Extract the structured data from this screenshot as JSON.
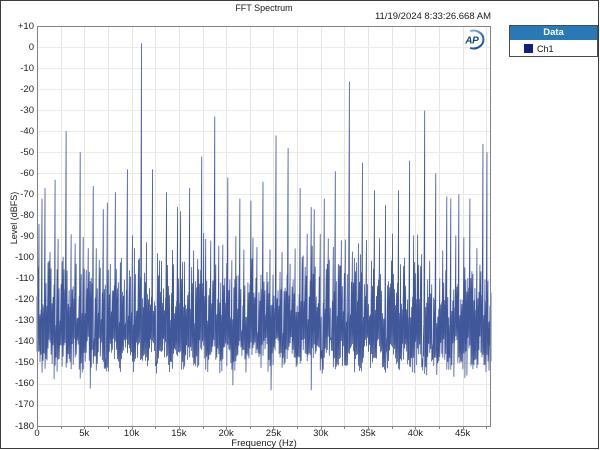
{
  "window": {
    "border_color": "#3c3c3c",
    "background": "#ffffff"
  },
  "header": {
    "title": "FFT Spectrum",
    "timestamp": "11/19/2024 8:33:26.668 AM"
  },
  "logo": {
    "text": "AP",
    "text_color": "#15457f",
    "arc_color": "#2b6cad"
  },
  "legend": {
    "header": "Data",
    "header_bg": "#2879b5",
    "header_text_color": "#ffffff",
    "items": [
      {
        "label": "Ch1",
        "swatch_color": "#141f7b"
      }
    ]
  },
  "chart_data": {
    "type": "line",
    "title": "FFT Spectrum",
    "xlabel": "Frequency (Hz)",
    "ylabel": "Level (dBFS)",
    "xlim": [
      0,
      48000
    ],
    "ylim": [
      -180,
      10
    ],
    "grid": true,
    "x_grid_step_hz": 2500,
    "y_grid_step_db": 10,
    "x_ticks": [
      {
        "value": 0,
        "label": "0"
      },
      {
        "value": 5000,
        "label": "5k"
      },
      {
        "value": 10000,
        "label": "10k"
      },
      {
        "value": 15000,
        "label": "15k"
      },
      {
        "value": 20000,
        "label": "20k"
      },
      {
        "value": 25000,
        "label": "25k"
      },
      {
        "value": 30000,
        "label": "30k"
      },
      {
        "value": 35000,
        "label": "35k"
      },
      {
        "value": 40000,
        "label": "40k"
      },
      {
        "value": 45000,
        "label": "45k"
      }
    ],
    "y_ticks": [
      {
        "value": 10,
        "label": "+10"
      },
      {
        "value": 0,
        "label": "0"
      },
      {
        "value": -10,
        "label": "-10"
      },
      {
        "value": -20,
        "label": "-20"
      },
      {
        "value": -30,
        "label": "-30"
      },
      {
        "value": -40,
        "label": "-40"
      },
      {
        "value": -50,
        "label": "-50"
      },
      {
        "value": -60,
        "label": "-60"
      },
      {
        "value": -70,
        "label": "-70"
      },
      {
        "value": -80,
        "label": "-80"
      },
      {
        "value": -90,
        "label": "-90"
      },
      {
        "value": -100,
        "label": "-100"
      },
      {
        "value": -110,
        "label": "-110"
      },
      {
        "value": -120,
        "label": "-120"
      },
      {
        "value": -130,
        "label": "-130"
      },
      {
        "value": -140,
        "label": "-140"
      },
      {
        "value": -150,
        "label": "-150"
      },
      {
        "value": -160,
        "label": "-160"
      },
      {
        "value": -170,
        "label": "-170"
      },
      {
        "value": -180,
        "label": "-180"
      }
    ],
    "series": [
      {
        "name": "Ch1",
        "color": "#40579a"
      }
    ],
    "peaks": [
      {
        "f": 250,
        "db": -84
      },
      {
        "f": 550,
        "db": -72
      },
      {
        "f": 800,
        "db": -67
      },
      {
        "f": 1870,
        "db": -63
      },
      {
        "f": 3100,
        "db": -40
      },
      {
        "f": 4550,
        "db": -50
      },
      {
        "f": 5900,
        "db": -66
      },
      {
        "f": 7000,
        "db": -77
      },
      {
        "f": 7450,
        "db": -74
      },
      {
        "f": 8300,
        "db": -69
      },
      {
        "f": 9600,
        "db": -58
      },
      {
        "f": 11000,
        "db": 1.8
      },
      {
        "f": 12250,
        "db": -58
      },
      {
        "f": 13700,
        "db": -69
      },
      {
        "f": 14850,
        "db": -76
      },
      {
        "f": 15150,
        "db": -78
      },
      {
        "f": 16100,
        "db": -67
      },
      {
        "f": 17400,
        "db": -52
      },
      {
        "f": 18800,
        "db": -33
      },
      {
        "f": 20200,
        "db": -62
      },
      {
        "f": 21400,
        "db": -72
      },
      {
        "f": 22600,
        "db": -73
      },
      {
        "f": 23900,
        "db": -64
      },
      {
        "f": 25300,
        "db": -42
      },
      {
        "f": 26600,
        "db": -48
      },
      {
        "f": 27800,
        "db": -67
      },
      {
        "f": 29000,
        "db": -76
      },
      {
        "f": 29300,
        "db": -77
      },
      {
        "f": 30400,
        "db": -72
      },
      {
        "f": 31500,
        "db": -59
      },
      {
        "f": 33000,
        "db": -16.4
      },
      {
        "f": 34400,
        "db": -55
      },
      {
        "f": 35700,
        "db": -68
      },
      {
        "f": 36900,
        "db": -75
      },
      {
        "f": 38200,
        "db": -68
      },
      {
        "f": 39400,
        "db": -54
      },
      {
        "f": 41000,
        "db": -30.2
      },
      {
        "f": 42200,
        "db": -60
      },
      {
        "f": 43300,
        "db": -71
      },
      {
        "f": 43700,
        "db": -72
      },
      {
        "f": 44600,
        "db": -70
      },
      {
        "f": 45800,
        "db": -72
      },
      {
        "f": 47200,
        "db": -46
      },
      {
        "f": 47550,
        "db": -50
      }
    ],
    "noise_floor": {
      "description": "dense noise hash drawn as per-column min/max envelope strokes",
      "top_db_max": -103,
      "top_db_min": -129,
      "bottom_db_max": -141,
      "bottom_db_min": -152,
      "comb_spacing_hz": 1340,
      "medium_spike_spacing_hz": 447,
      "medium_spike_db": -95,
      "min_db": -163,
      "columns": 452,
      "seed": 20241119
    }
  }
}
